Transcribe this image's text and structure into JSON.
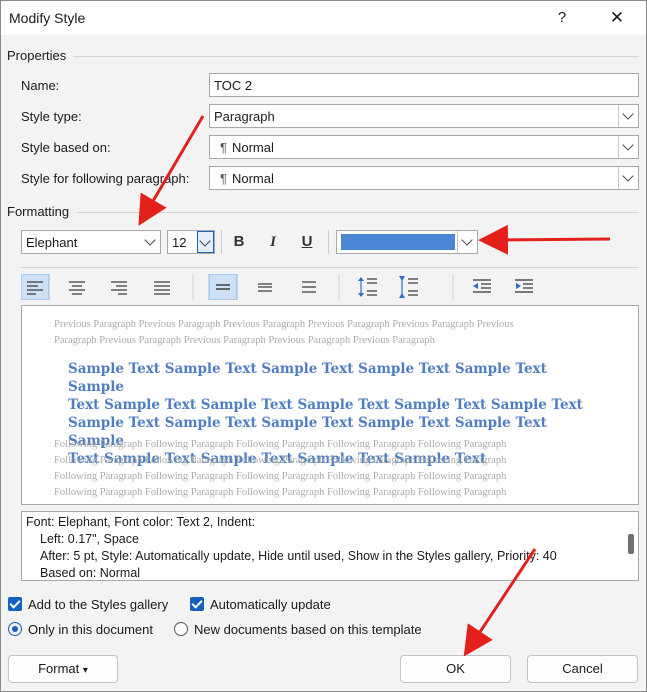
{
  "window": {
    "title": "Modify Style",
    "help_glyph": "?",
    "close_glyph": "✕"
  },
  "properties": {
    "group_label": "Properties",
    "name_label": "Name:",
    "name_value": "TOC 2",
    "style_type_label": "Style type:",
    "style_type_value": "Paragraph",
    "based_on_label": "Style based on:",
    "based_on_value": "Normal",
    "following_label": "Style for following paragraph:",
    "following_value": "Normal",
    "paragraph_mark": "¶"
  },
  "formatting": {
    "group_label": "Formatting",
    "font": "Elephant",
    "size": "12",
    "bold": "B",
    "italic": "I",
    "underline": "U",
    "font_color": "#4a86d4"
  },
  "preview": {
    "previous": [
      "Previous Paragraph Previous Paragraph Previous Paragraph Previous Paragraph Previous Paragraph Previous",
      "Paragraph Previous Paragraph Previous Paragraph Previous Paragraph Previous Paragraph"
    ],
    "sample": [
      "Sample Text Sample Text Sample Text Sample Text Sample Text Sample",
      "Text Sample Text Sample Text Sample Text Sample Text Sample Text",
      "Sample Text Sample Text Sample Text Sample Text Sample Text Sample",
      "Text Sample Text Sample Text Sample Text Sample Text"
    ],
    "following": [
      "Following Paragraph Following Paragraph Following Paragraph Following Paragraph Following Paragraph",
      "Following Paragraph Following Paragraph Following Paragraph Following Paragraph Following Paragraph",
      "Following Paragraph Following Paragraph Following Paragraph Following Paragraph Following Paragraph",
      "Following Paragraph Following Paragraph Following Paragraph Following Paragraph Following Paragraph"
    ]
  },
  "description": {
    "line1": "Font: Elephant, Font color: Text 2, Indent:",
    "line2": "Left:  0.17\", Space",
    "line3": "After:  5 pt, Style: Automatically update, Hide until used, Show in the Styles gallery, Priority: 40",
    "line4": "Based on: Normal"
  },
  "options": {
    "add_to_gallery": "Add to the Styles gallery",
    "auto_update": "Automatically update",
    "only_this_doc": "Only in this document",
    "new_docs": "New documents based on this template"
  },
  "buttons": {
    "format": "Format",
    "format_caret": "▾",
    "ok": "OK",
    "cancel": "Cancel"
  },
  "colors": {
    "accent": "#1560bd",
    "arrow": "#e3201b"
  }
}
